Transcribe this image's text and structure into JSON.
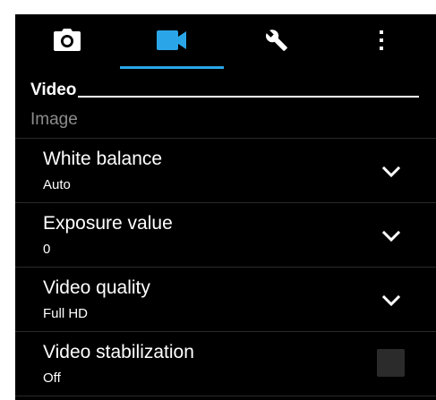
{
  "tabs": [
    {
      "icon": "camera-icon",
      "selected": false
    },
    {
      "icon": "video-camera-icon",
      "selected": true
    },
    {
      "icon": "wrench-icon",
      "selected": false
    },
    {
      "icon": "more-vertical-icon",
      "selected": false
    }
  ],
  "section_title": "Video",
  "group_label": "Image",
  "settings": [
    {
      "title": "White balance",
      "value": "Auto",
      "control": "dropdown"
    },
    {
      "title": "Exposure value",
      "value": "0",
      "control": "dropdown"
    },
    {
      "title": "Video quality",
      "value": "Full HD",
      "control": "dropdown"
    },
    {
      "title": "Video stabilization",
      "value": "Off",
      "control": "checkbox",
      "checked": false
    }
  ],
  "colors": {
    "background": "#000000",
    "accent": "#2aa6e8",
    "text": "#ffffff",
    "group_label": "#8c8c8c"
  }
}
